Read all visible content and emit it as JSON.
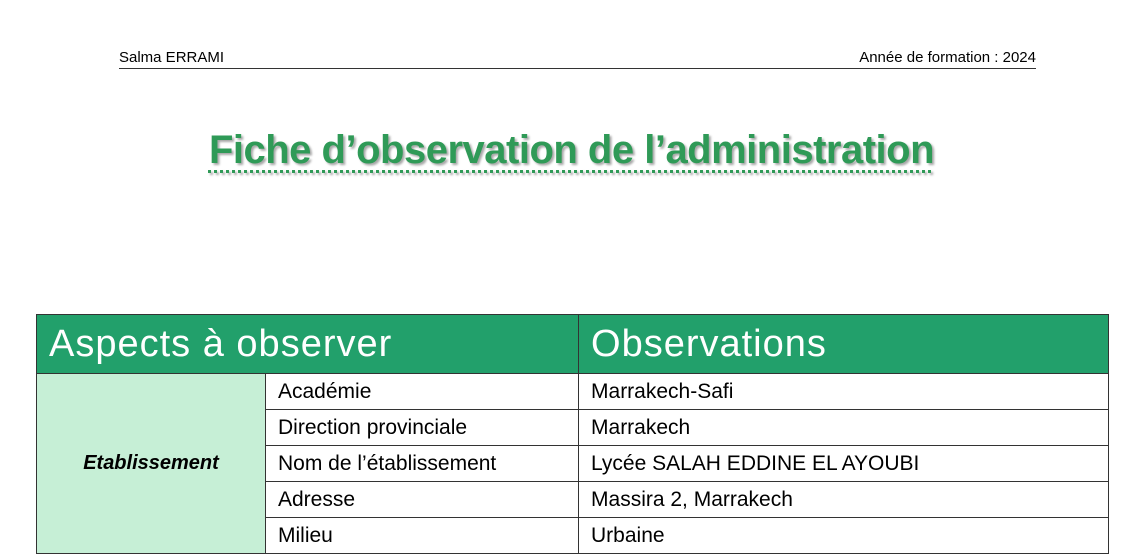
{
  "header": {
    "author": "Salma ERRAMI",
    "year_label": "Année de formation : 2024"
  },
  "title": "Fiche d’observation de l’administration",
  "table": {
    "col_aspects": "Aspects à observer",
    "col_observations": "Observations",
    "category": "Etablissement",
    "rows": [
      {
        "aspect": "Académie",
        "observation": "Marrakech-Safi"
      },
      {
        "aspect": "Direction provinciale",
        "observation": "Marrakech"
      },
      {
        "aspect": "Nom de l’établissement",
        "observation": "Lycée SALAH EDDINE EL AYOUBI"
      },
      {
        "aspect": "Adresse",
        "observation": "Massira 2, Marrakech"
      },
      {
        "aspect": "Milieu",
        "observation": "Urbaine"
      }
    ]
  },
  "colors": {
    "title_green": "#2f9a57",
    "header_green": "#22a06b",
    "category_bg": "#c6efd6"
  }
}
